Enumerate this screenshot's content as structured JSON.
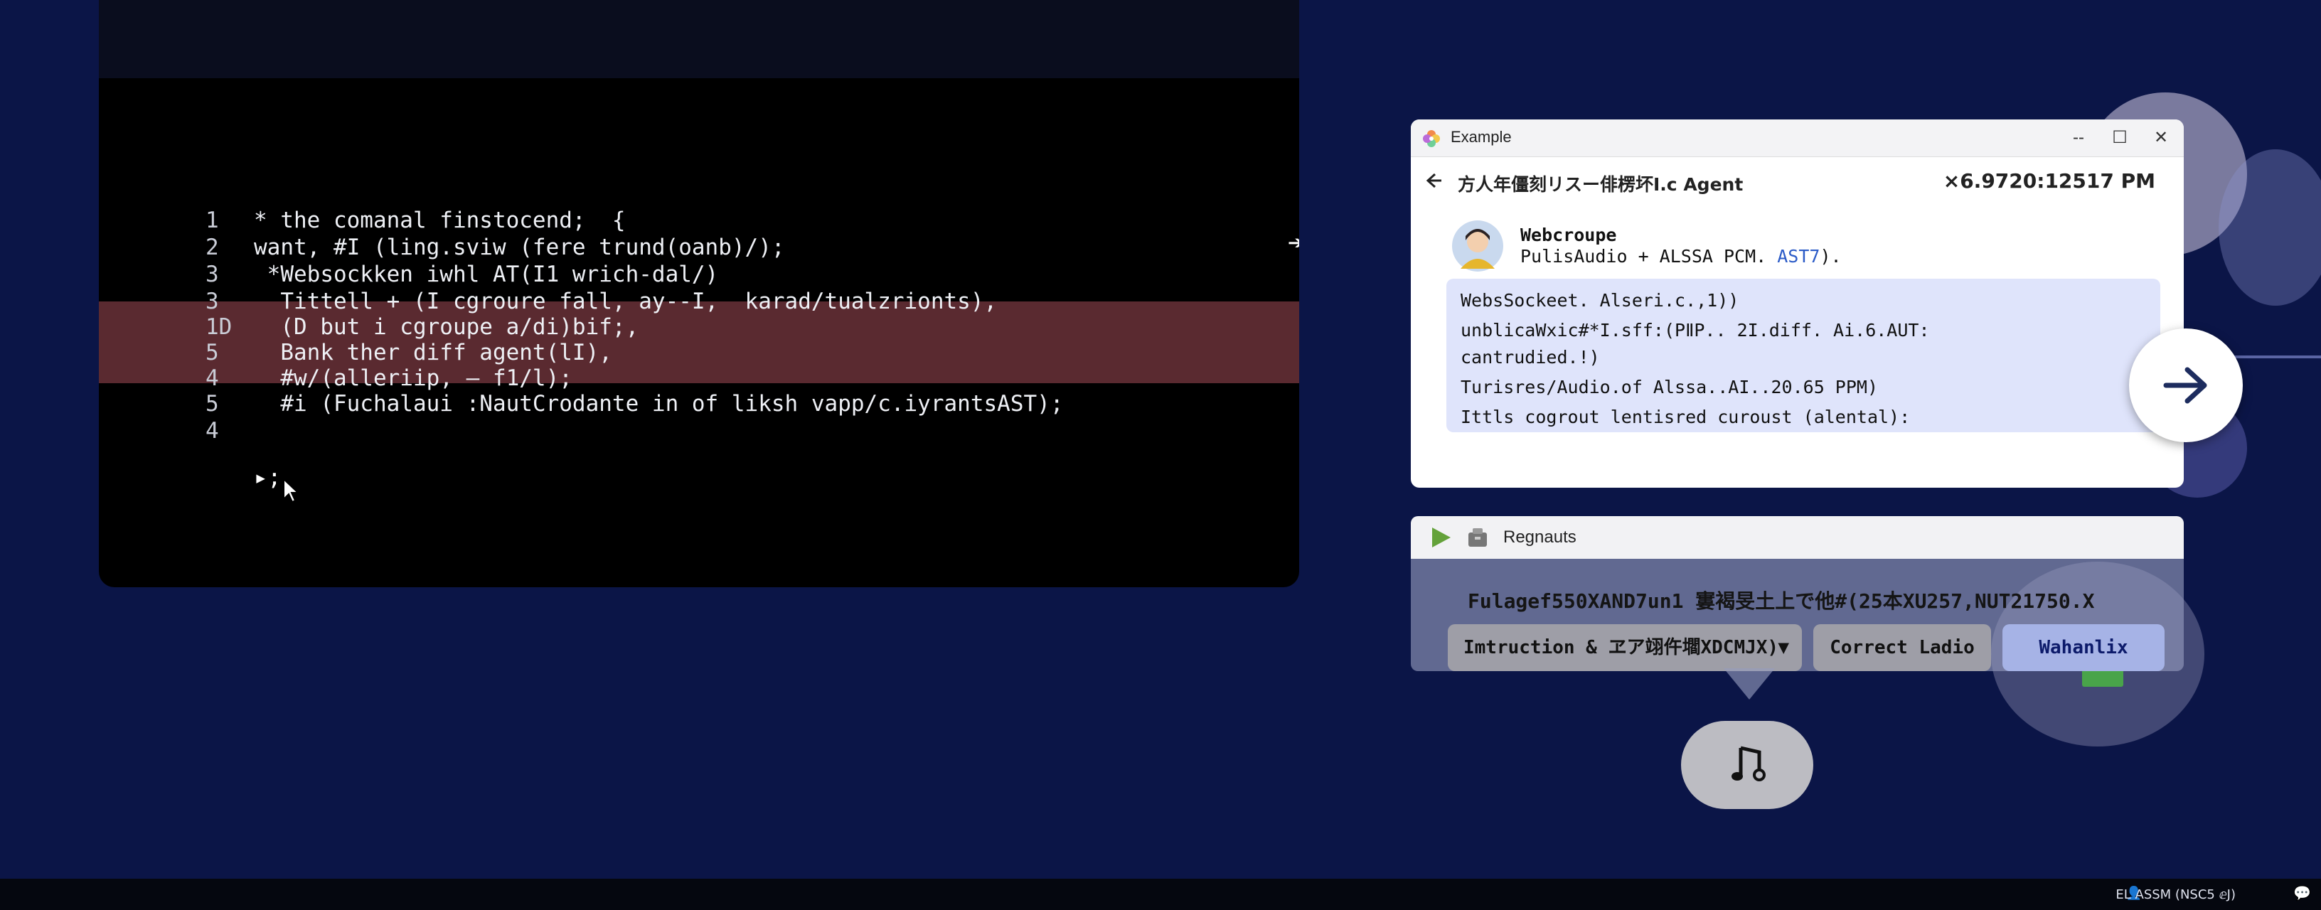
{
  "editor": {
    "lines": [
      {
        "num": "1",
        "text": "* the comanal finstocend;  {"
      },
      {
        "num": "2",
        "text": "want, #I (ling.sviw (fere trund(oanb)/);"
      },
      {
        "num": "3",
        "text": " *Websockken iwhl AT(I1 wrich-dal/)"
      },
      {
        "num": "3",
        "text": "  Tittell + (I cgroure fall, ay--I,  karad/tualzrionts),"
      },
      {
        "num": "1D",
        "text": "  (D but i cgroupe a/di)bif;,"
      },
      {
        "num": "5",
        "text": "  Bank ther diff agent(lI),"
      },
      {
        "num": "4",
        "text": "  #w/(alleriip, – f1/l);"
      },
      {
        "num": "5",
        "text": "  #i (Fuchalaui :NautCrodante in of liksh vapp/c.iyrantsAST);"
      },
      {
        "num": "4",
        "text": ""
      }
    ],
    "prompt": "▸;"
  },
  "window": {
    "title": "Example",
    "controls": {
      "minimize": "--",
      "maximize": "☐",
      "close": "✕"
    },
    "chat_title": "方人年僵刻リスー俳楞坏I.c Agent",
    "chat_time": "×6.9720:12517 PM",
    "sender_name": "Webcroupe",
    "sender_sub": "PulisAudio + ALSSA PCM.",
    "sender_link": "AST7",
    "sender_tail": ").",
    "message_lines": [
      "WebsSockeet. Alseri.c.,1))",
      "unblicaWxic#*I.sff:(PⅡP.. 2I.diff. Ai.6.AUT:",
      "cantrudied.!)",
      "Turisres/Audio.of Alssa..AI..20.65 PPM)",
      "Ittls cogrout lentisred curoust (alental):"
    ]
  },
  "panel2": {
    "label": "Regnauts",
    "status_text": "Fulagef550XAND7un1 寠褐旻土上で他#(25本XU257,NUT21750.X",
    "dropdown_label": "Imtruction & ヱア翊仵壛XDCMJX)",
    "correct_label": "Correct Ladio",
    "action_label": "Wahanlix"
  },
  "taskbar": {
    "tray_text": "EL ASSM (NSC5 ⅇJ)"
  },
  "colors": {
    "accent": "#2b5bc7",
    "highlight_row": "#5a2a30",
    "background": "#0b1547"
  }
}
